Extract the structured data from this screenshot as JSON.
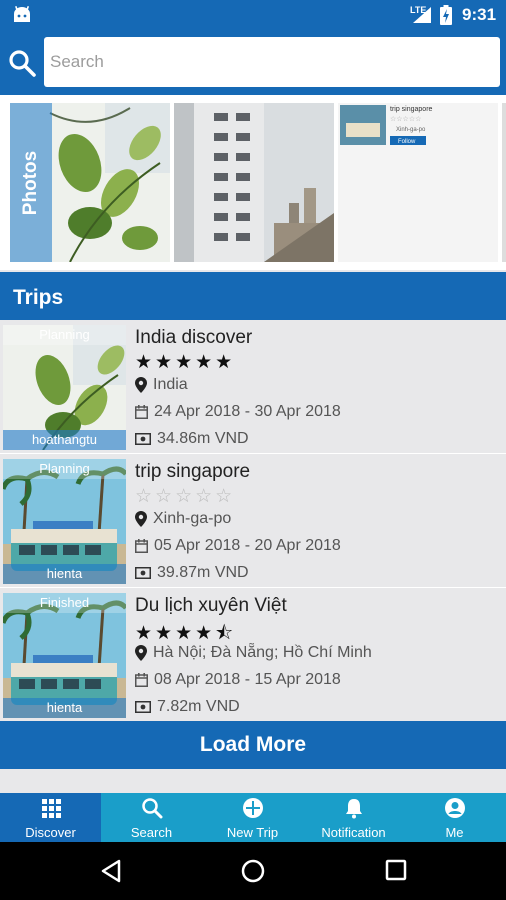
{
  "status_bar": {
    "time": "9:31",
    "network": "LTE"
  },
  "search": {
    "placeholder": "Search"
  },
  "photos": {
    "label": "Photos",
    "preview": {
      "title": "trip singapore",
      "location": "Xinh-ga-po",
      "follow": "Follow"
    }
  },
  "trips_header": "Trips",
  "trips": [
    {
      "status": "Planning",
      "owner": "hoathangtu",
      "name": "India discover",
      "rating": 5,
      "stars": "★★★★★",
      "location": "India",
      "dates": "24 Apr 2018 -  30 Apr 2018",
      "cost": "34.86m VND"
    },
    {
      "status": "Planning",
      "owner": "hienta",
      "name": "trip singapore",
      "rating": 0,
      "stars": "☆☆☆☆☆",
      "location": "Xinh-ga-po",
      "dates": "05 Apr 2018 -  20 Apr 2018",
      "cost": "39.87m VND"
    },
    {
      "status": "Finished",
      "owner": "hienta",
      "name": "Du lịch xuyên Việt",
      "rating": 4.5,
      "stars": "★★★★⯪",
      "location": "Hà Nội; Đà Nẵng; Hồ Chí Minh",
      "dates": "08 Apr 2018 -  15 Apr 2018",
      "cost": "7.82m VND"
    }
  ],
  "load_more": "Load More",
  "bottom_nav": [
    {
      "label": "Discover",
      "icon": "grid-icon",
      "active": true
    },
    {
      "label": "Search",
      "icon": "search-icon",
      "active": false
    },
    {
      "label": "New Trip",
      "icon": "add-circle-icon",
      "active": false
    },
    {
      "label": "Notification",
      "icon": "bell-icon",
      "active": false
    },
    {
      "label": "Me",
      "icon": "person-icon",
      "active": false
    }
  ],
  "colors": {
    "primary": "#1569b5",
    "nav": "#1a9ec9",
    "background": "#e8e8ea"
  }
}
